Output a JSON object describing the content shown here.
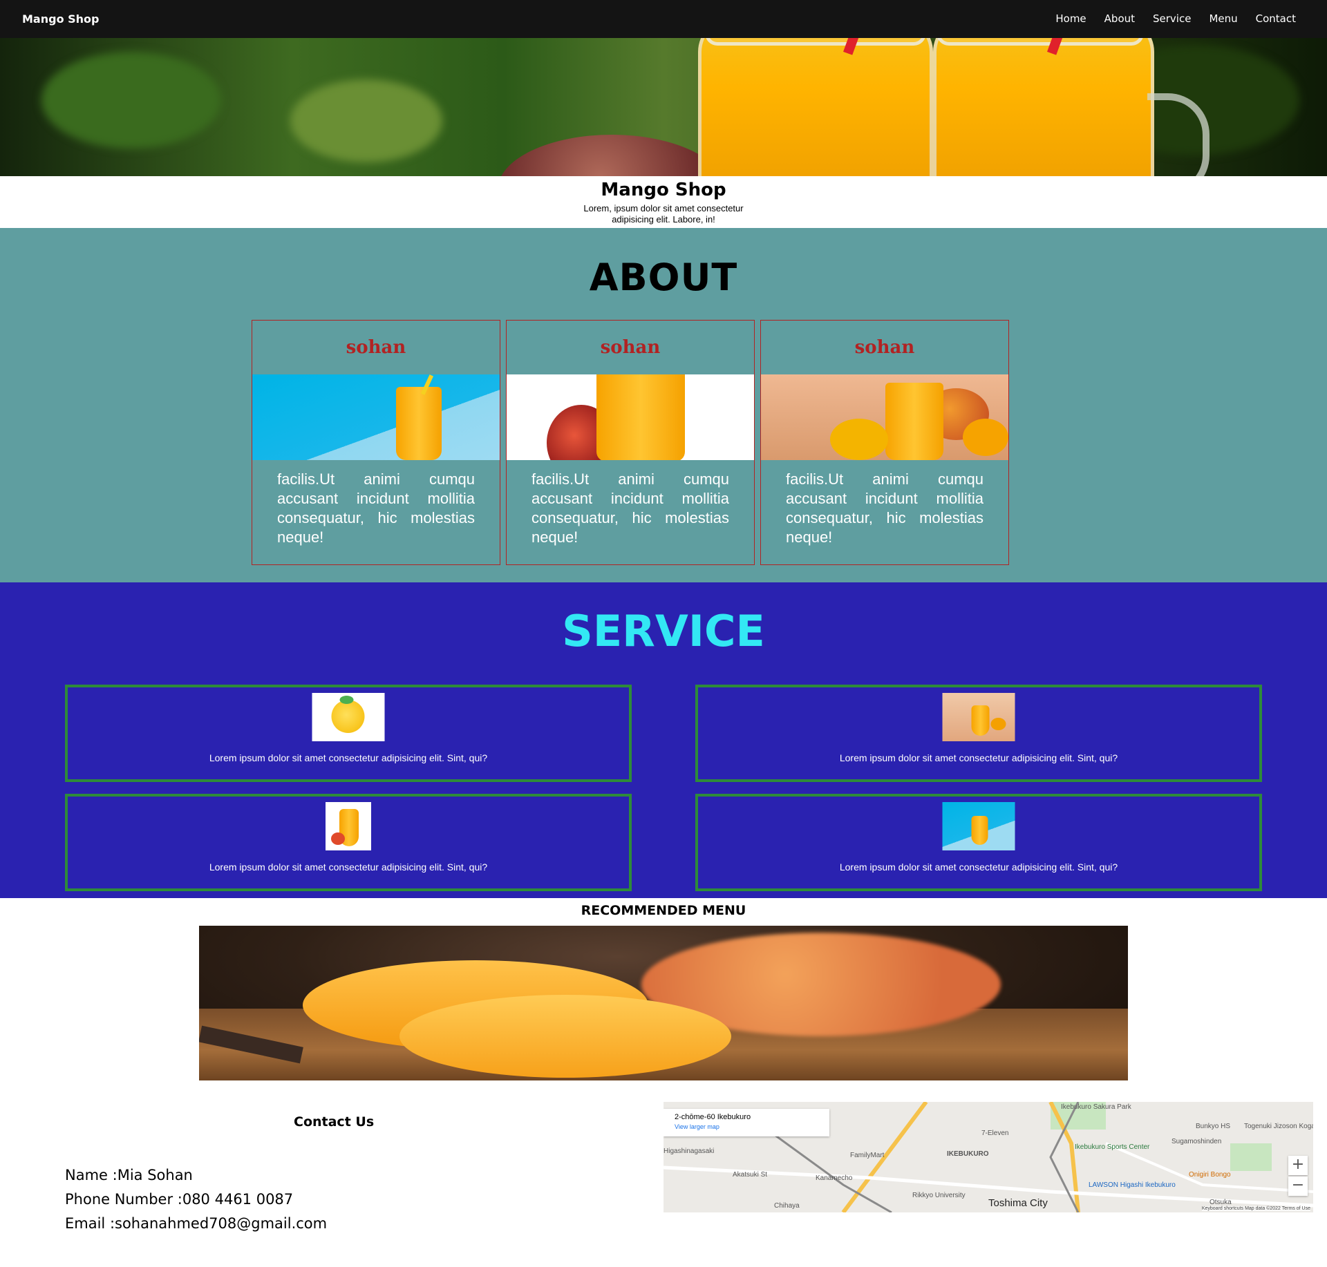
{
  "nav": {
    "brand": "Mango Shop",
    "links": [
      "Home",
      "About",
      "Service",
      "Menu",
      "Contact"
    ]
  },
  "hero": {
    "title": "Mango Shop",
    "subtitle": "Lorem, ipsum dolor sit amet consectetur adipisicing elit. Labore, in!"
  },
  "about": {
    "heading": "ABOUT",
    "cards": [
      {
        "title": "sohan",
        "text": "facilis.Ut animi cumqu accusant incidunt mollitia consequatur, hic molestias neque!"
      },
      {
        "title": "sohan",
        "text": "facilis.Ut animi cumqu accusant incidunt mollitia consequatur, hic molestias neque!"
      },
      {
        "title": "sohan",
        "text": "facilis.Ut animi cumqu accusant incidunt mollitia consequatur, hic molestias neque!"
      }
    ]
  },
  "service": {
    "heading": "SERVICE",
    "items": [
      {
        "text": "Lorem ipsum dolor sit amet consectetur adipisicing elit. Sint, qui?"
      },
      {
        "text": "Lorem ipsum dolor sit amet consectetur adipisicing elit. Sint, qui?"
      },
      {
        "text": "Lorem ipsum dolor sit amet consectetur adipisicing elit. Sint, qui?"
      },
      {
        "text": "Lorem ipsum dolor sit amet consectetur adipisicing elit. Sint, qui?"
      }
    ]
  },
  "menu": {
    "heading": "RECOMMENDED MENU"
  },
  "contact": {
    "heading": "Contact Us",
    "name": "Name :Mia Sohan",
    "phone": "Phone Number :080 4461 0087",
    "email": "Email :sohanahmed708@gmail.com"
  },
  "map": {
    "address": "2-chōme-60 Ikebukuro",
    "view_larger": "View larger map",
    "labels": {
      "ikebukuro": "IKEBUKURO",
      "toshima": "Toshima City",
      "family_mart": "FamilyMart",
      "seven_eleven": "7-Eleven",
      "sports_center": "Ikebukuro Sports Center",
      "lawson": "LAWSON Higashi Ikebukuro",
      "onigiri": "Onigiri Bongo",
      "rikkyo": "Rikkyo University",
      "chihaya": "Chihaya",
      "kanamecho": "Kanamecho",
      "bunkyo": "Bunkyo HS",
      "togenuki": "Togenuki Jizoson Koganji Temple",
      "sugamoshinden": "Sugamoshinden",
      "otsuka": "Otsuka",
      "sakura_park": "Ikebukuro Sakura Park",
      "akatsuki": "Akatsuki St",
      "higashinagasaki": "Higashinagasaki"
    },
    "zoom_in": "+",
    "zoom_out": "−",
    "footer": "Keyboard shortcuts   Map data ©2022   Terms of Use",
    "colors": {
      "road_main": "#f6c24b",
      "road": "#ffffff",
      "park": "#c8e6c0",
      "rail": "#8a8a8a"
    }
  },
  "colors": {
    "nav_bg": "#141414",
    "about_bg": "#5f9ea0",
    "card_border": "#b22222",
    "service_bg": "#2a22b0",
    "service_title": "#33e8f4",
    "service_border": "#2e8b3a"
  }
}
